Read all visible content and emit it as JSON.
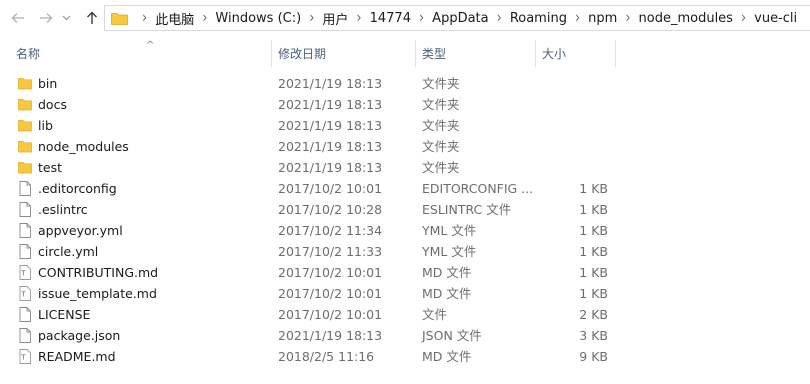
{
  "nav": {
    "back_icon": "arrow-left-icon",
    "forward_icon": "arrow-right-icon",
    "dropdown_icon": "chevron-down-icon",
    "up_icon": "arrow-up-icon"
  },
  "breadcrumb": [
    "此电脑",
    "Windows (C:)",
    "用户",
    "14774",
    "AppData",
    "Roaming",
    "npm",
    "node_modules",
    "vue-cli"
  ],
  "columns": {
    "name": "名称",
    "date": "修改日期",
    "type": "类型",
    "size": "大小",
    "sort_indicator": "^"
  },
  "colors": {
    "folder": "#f8c73e",
    "header_text": "#4c607a",
    "secondary_text": "#6d6d6d"
  },
  "files": [
    {
      "name": "bin",
      "date": "2021/1/19 18:13",
      "type": "文件夹",
      "size": "",
      "icon": "folder"
    },
    {
      "name": "docs",
      "date": "2021/1/19 18:13",
      "type": "文件夹",
      "size": "",
      "icon": "folder"
    },
    {
      "name": "lib",
      "date": "2021/1/19 18:13",
      "type": "文件夹",
      "size": "",
      "icon": "folder"
    },
    {
      "name": "node_modules",
      "date": "2021/1/19 18:13",
      "type": "文件夹",
      "size": "",
      "icon": "folder"
    },
    {
      "name": "test",
      "date": "2021/1/19 18:13",
      "type": "文件夹",
      "size": "",
      "icon": "folder"
    },
    {
      "name": ".editorconfig",
      "date": "2017/10/2 10:01",
      "type": "EDITORCONFIG ...",
      "size": "1 KB",
      "icon": "file"
    },
    {
      "name": ".eslintrc",
      "date": "2017/10/2 10:28",
      "type": "ESLINTRC 文件",
      "size": "1 KB",
      "icon": "file"
    },
    {
      "name": "appveyor.yml",
      "date": "2017/10/2 11:34",
      "type": "YML 文件",
      "size": "1 KB",
      "icon": "file"
    },
    {
      "name": "circle.yml",
      "date": "2017/10/2 11:33",
      "type": "YML 文件",
      "size": "1 KB",
      "icon": "file"
    },
    {
      "name": "CONTRIBUTING.md",
      "date": "2017/10/2 10:01",
      "type": "MD 文件",
      "size": "1 KB",
      "icon": "text-file"
    },
    {
      "name": "issue_template.md",
      "date": "2017/10/2 10:01",
      "type": "MD 文件",
      "size": "1 KB",
      "icon": "text-file"
    },
    {
      "name": "LICENSE",
      "date": "2017/10/2 10:01",
      "type": "文件",
      "size": "2 KB",
      "icon": "file"
    },
    {
      "name": "package.json",
      "date": "2021/1/19 18:13",
      "type": "JSON 文件",
      "size": "3 KB",
      "icon": "file"
    },
    {
      "name": "README.md",
      "date": "2018/2/5 11:16",
      "type": "MD 文件",
      "size": "9 KB",
      "icon": "text-file"
    }
  ]
}
